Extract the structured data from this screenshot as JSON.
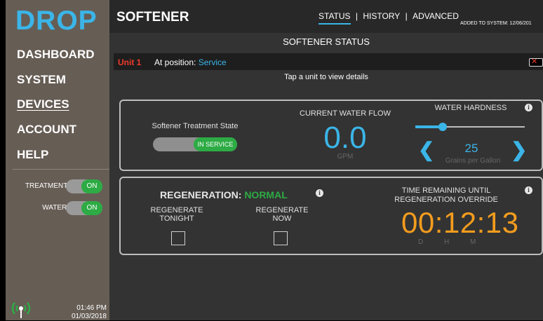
{
  "brand": {
    "logo": "DROP"
  },
  "sidebar": {
    "nav": [
      {
        "label": "DASHBOARD",
        "active": false
      },
      {
        "label": "SYSTEM",
        "active": false
      },
      {
        "label": "DEVICES",
        "active": true
      },
      {
        "label": "ACCOUNT",
        "active": false
      },
      {
        "label": "HELP",
        "active": false
      }
    ],
    "toggles": [
      {
        "label": "TREATMENT:",
        "state": "ON"
      },
      {
        "label": "WATER:",
        "state": "ON"
      }
    ],
    "clock": {
      "time": "01:46 PM",
      "date": "01/03/2018"
    },
    "icon": "wifi-signal-icon"
  },
  "header": {
    "title": "SOFTENER",
    "tabs": [
      {
        "label": "STATUS",
        "active": true
      },
      {
        "label": "HISTORY",
        "active": false
      },
      {
        "label": "ADVANCED",
        "active": false
      }
    ],
    "separator": "|",
    "added": "ADDED TO SYSTEM: 12/06/201"
  },
  "status": {
    "title": "SOFTENER STATUS",
    "unit": "Unit 1",
    "position_label": "At position:",
    "position_value": "Service",
    "hint": "Tap a unit to view details",
    "battery_icon": "battery-empty-icon"
  },
  "treatment": {
    "label": "Softener Treatment State",
    "toggle": "IN SERVICE"
  },
  "flow": {
    "label": "CURRENT WATER FLOW",
    "value": "0.0",
    "unit": "GPM"
  },
  "hardness": {
    "label": "WATER HARDNESS",
    "value": "25",
    "unit": "Grains per Gallon",
    "slider_fraction": 0.25
  },
  "regeneration": {
    "label": "REGENERATION:",
    "status": "NORMAL",
    "tonight": "REGENERATE TONIGHT",
    "now": "REGENERATE NOW"
  },
  "override": {
    "label": "TIME REMAINING UNTIL REGENERATION OVERRIDE",
    "timer": "00:12:13",
    "units": [
      "D",
      "H",
      "M"
    ]
  },
  "colors": {
    "accent": "#3bb5e8",
    "on": "#2dab44",
    "alert": "#ef3b2c",
    "timer": "#f39c1e"
  }
}
